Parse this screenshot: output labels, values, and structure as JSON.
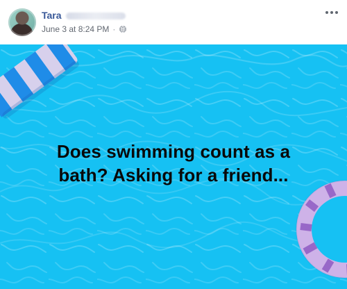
{
  "post": {
    "author": {
      "first_name": "Tara"
    },
    "meta": {
      "timestamp": "June 3 at 8:24 PM",
      "separator": "·",
      "privacy_icon": "globe-icon"
    },
    "menu": {
      "icon": "more-horizontal-icon"
    },
    "status": {
      "text": "Does swimming count as a\nbath? Asking for a friend..."
    }
  },
  "theme": {
    "link_color": "#385898",
    "meta_color": "#616770",
    "background": "#ffffff",
    "pool_blue": "#16c1f3",
    "text_color": "#090909"
  }
}
